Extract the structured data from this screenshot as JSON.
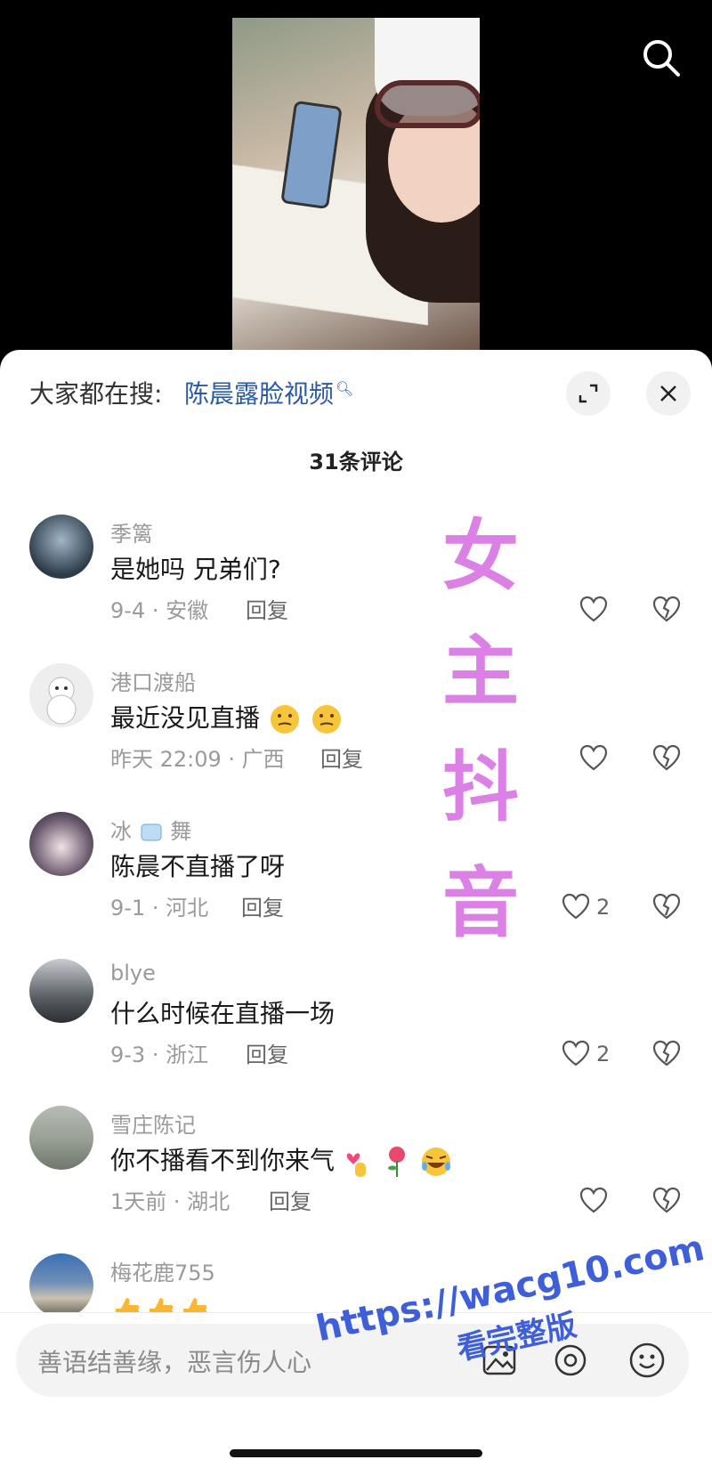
{
  "header": {
    "hot_search_prefix": "大家都在搜:",
    "hot_search_query": "陈晨露脸视频",
    "comment_count": "31条评论"
  },
  "comments": [
    {
      "user": "季篱",
      "text": "是她吗 兄弟们?",
      "meta": "9-4 · 安徽",
      "reply": "回复",
      "likes": ""
    },
    {
      "user": "港口渡船",
      "text": "最近没见直播",
      "meta": "昨天 22:09 · 广西",
      "reply": "回复",
      "likes": "",
      "emojis": [
        "thinking-face",
        "thinking-face"
      ]
    },
    {
      "user": "冰",
      "user_suffix": "舞",
      "text": "陈晨不直播了呀",
      "meta": "9-1 · 河北",
      "reply": "回复",
      "likes": "2"
    },
    {
      "user": "blye",
      "text": "什么时候在直播一场",
      "meta": "9-3 · 浙江",
      "reply": "回复",
      "likes": "2"
    },
    {
      "user": "雪庄陈记",
      "text": "你不播看不到你来气",
      "meta": "1天前 · 湖北",
      "reply": "回复",
      "likes": "",
      "emojis": [
        "finger-heart",
        "rose",
        "laughing-tears"
      ]
    },
    {
      "user": "梅花鹿755",
      "text": "",
      "meta": "",
      "reply": "",
      "likes": "",
      "emojis": [
        "thumbs-up",
        "thumbs-up",
        "thumbs-up"
      ]
    }
  ],
  "overlay_text": [
    "女",
    "主",
    "抖",
    "音"
  ],
  "composer": {
    "placeholder": "善语结善缘，恶言伤人心"
  },
  "watermark": {
    "url": "https://wacg10.com",
    "caption": "看完整版"
  },
  "colors": {
    "link": "#2c5aa0",
    "overlay": "#d56ae0",
    "watermark": "#3f5fd8"
  }
}
